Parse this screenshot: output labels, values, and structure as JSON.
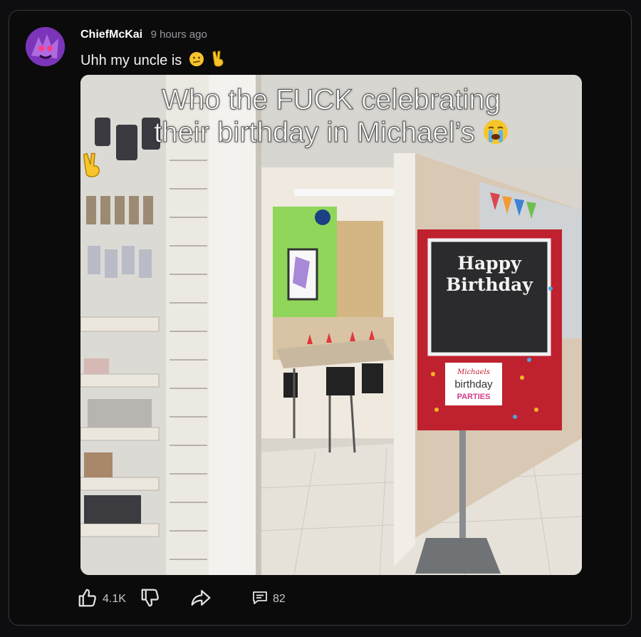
{
  "post": {
    "username": "ChiefMcKai",
    "time": "9 hours ago",
    "comment_text": "Uhh my uncle is",
    "comment_emojis": [
      "confused-face-icon",
      "victory-hand-icon"
    ]
  },
  "media": {
    "caption_line1": "Who the FUCK celebrating",
    "caption_line2": "their birthday in Michael’s",
    "sign_line1": "Happy",
    "sign_line2": "Birthday",
    "sign_brand": "Michaels",
    "sign_sub1": "birthday",
    "sign_sub2": "PARTIES"
  },
  "actions": {
    "upvotes": "4.1K",
    "comments": "82"
  },
  "colors": {
    "background": "#0e0e10",
    "card_border": "#3a3a3d",
    "text": "#f2f2f2",
    "muted": "#9a9a9f",
    "sign_red": "#c0212f"
  }
}
